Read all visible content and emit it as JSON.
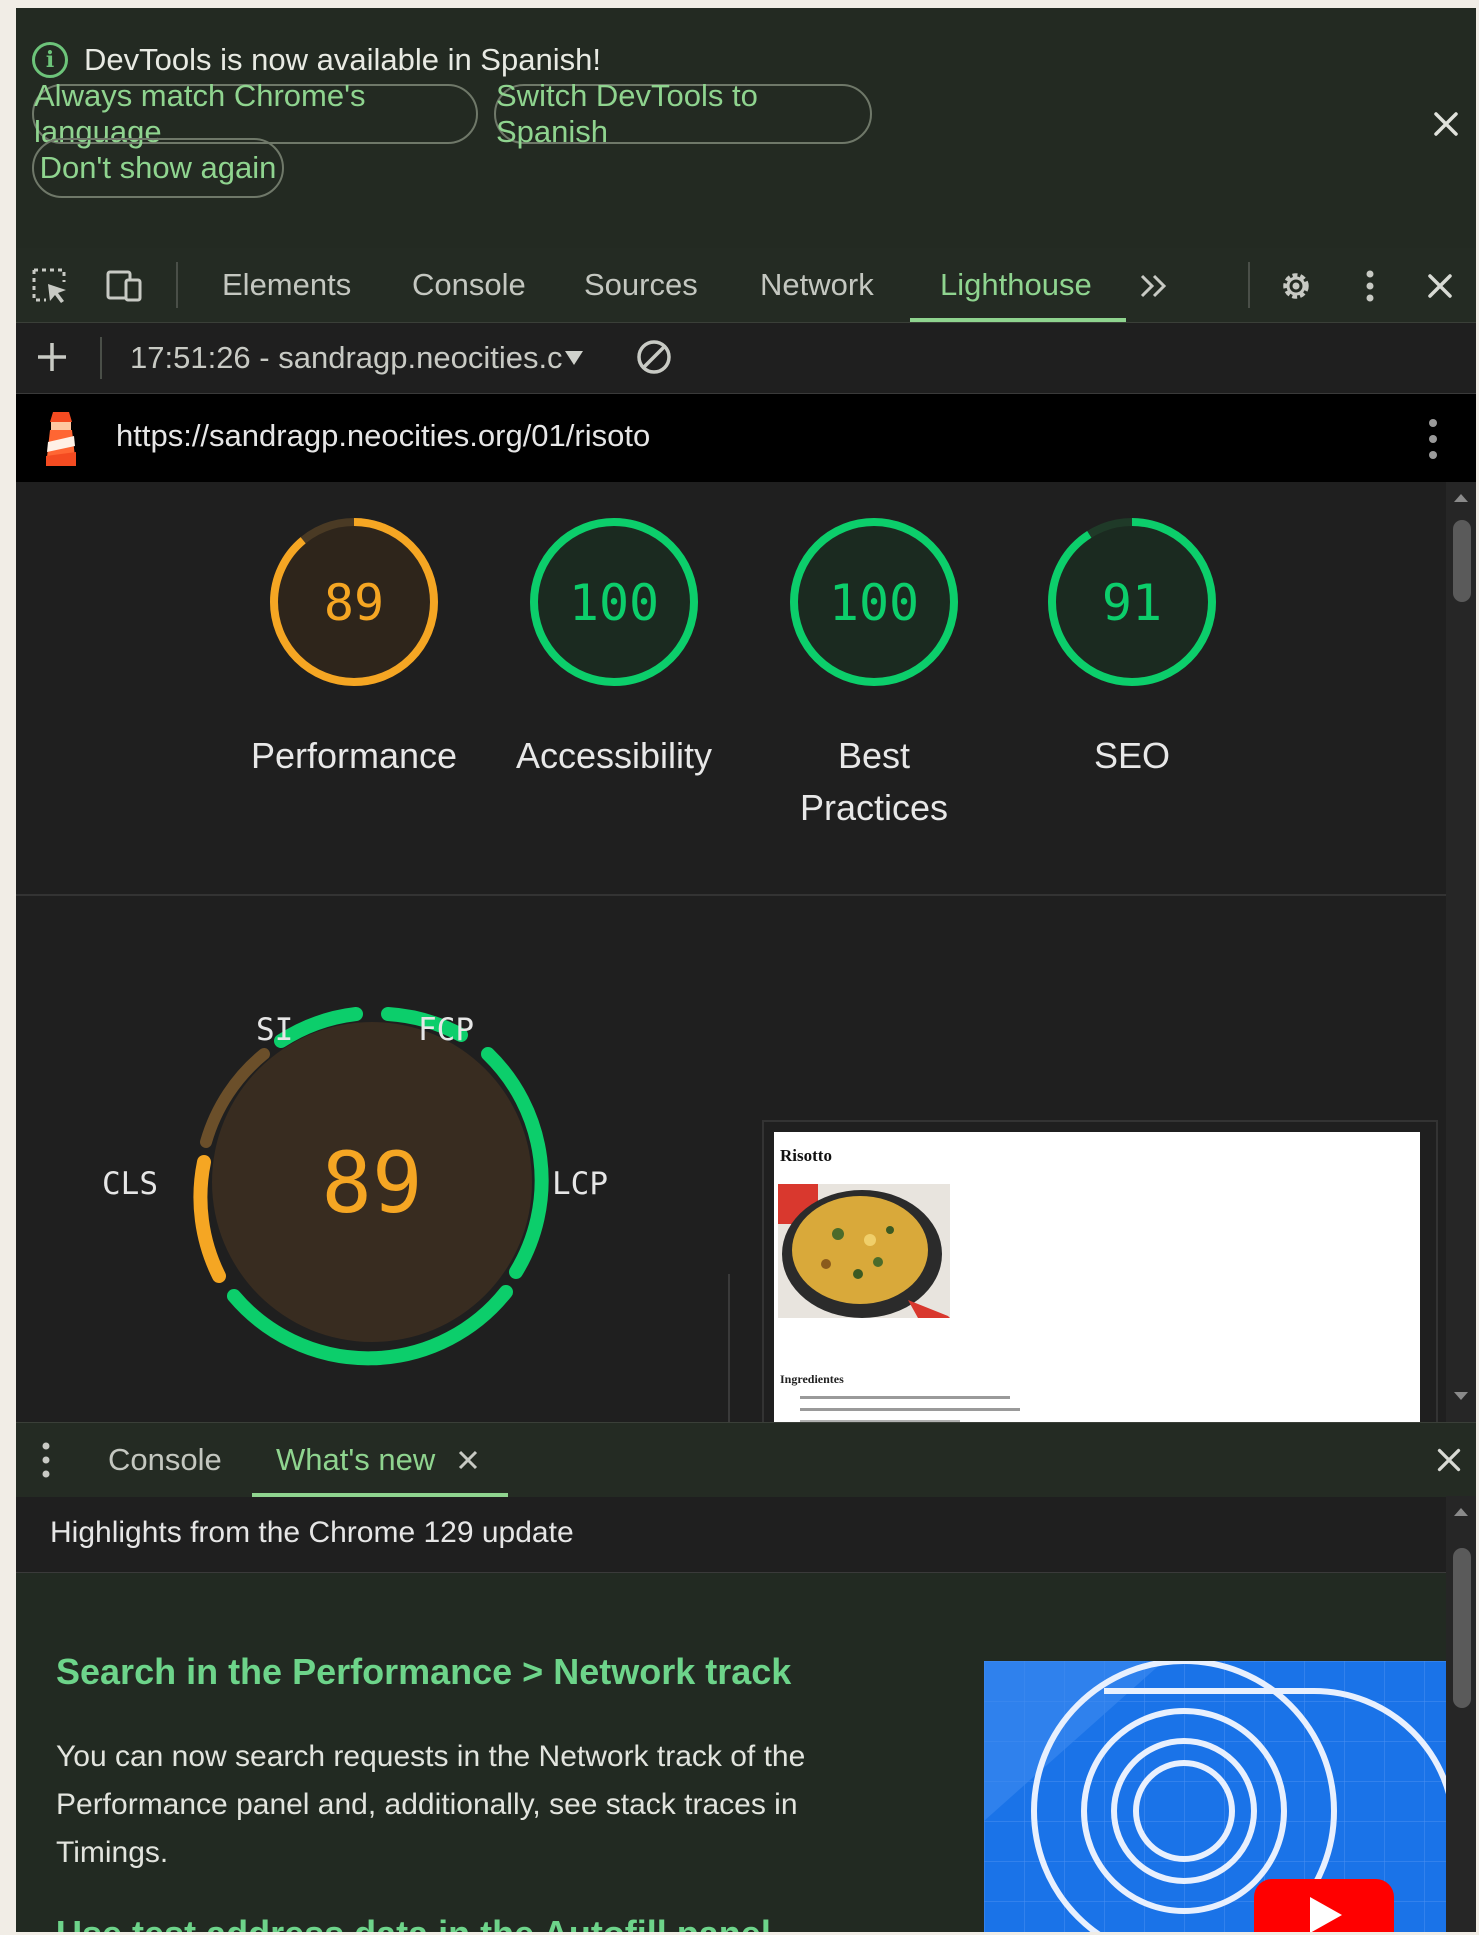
{
  "infobar": {
    "message": "DevTools is now available in Spanish!",
    "buttons": [
      "Always match Chrome's language",
      "Switch DevTools to Spanish",
      "Don't show again"
    ]
  },
  "toolbar": {
    "tabs": [
      "Elements",
      "Console",
      "Sources",
      "Network",
      "Lighthouse"
    ],
    "active_tab": "Lighthouse",
    "accent_color": "#8fd48f"
  },
  "lighthouse_toolbar": {
    "report_selector": "17:51:26 - sandragp.neocities.c"
  },
  "url_bar": {
    "url": "https://sandragp.neocities.org/01/risoto"
  },
  "scores": [
    {
      "value": "89",
      "label": "Performance",
      "score": 89,
      "color": "#f5a623"
    },
    {
      "value": "100",
      "label": "Accessibility",
      "score": 100,
      "color": "#0cce6b"
    },
    {
      "value": "100",
      "label": "Best Practices",
      "score": 100,
      "color": "#0cce6b"
    },
    {
      "value": "91",
      "label": "SEO",
      "score": 91,
      "color": "#0cce6b"
    }
  ],
  "performance_gauge": {
    "score": "89",
    "metrics": [
      "SI",
      "FCP",
      "LCP",
      "CLS"
    ]
  },
  "screenshot": {
    "title": "Risotto",
    "section": "Ingredientes"
  },
  "drawer": {
    "tabs": [
      "Console",
      "What's new"
    ],
    "active_tab": "What's new",
    "highlights": "Highlights from the Chrome 129 update",
    "feature_title": "Search in the Performance > Network track",
    "feature_body": "You can now search requests in the Network track of the Performance panel and, additionally, see stack traces in Timings.",
    "next_title": "Use test address data in the Autofill panel"
  }
}
